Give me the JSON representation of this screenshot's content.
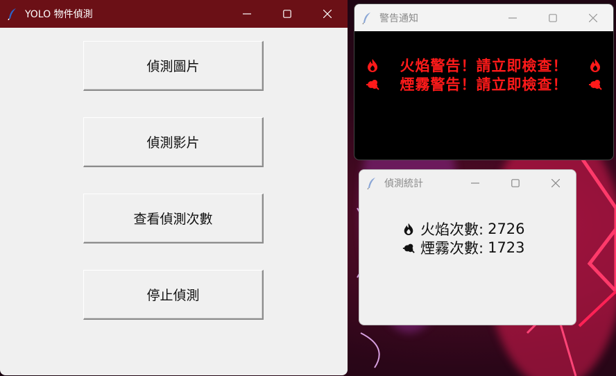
{
  "main_window": {
    "title": "YOLO 物件偵測",
    "buttons": [
      "偵測圖片",
      "偵測影片",
      "查看偵測次數",
      "停止偵測"
    ]
  },
  "alert_window": {
    "title": "警告通知",
    "fire_message": "火焰警告！請立即檢查！",
    "smoke_message": "煙霧警告！請立即檢查！",
    "text_color": "#ff1a1a"
  },
  "stats_window": {
    "title": "偵測統計",
    "fire_label": "火焰次數:",
    "fire_count": "2726",
    "smoke_label": "煙霧次數:",
    "smoke_count": "1723"
  },
  "icons": {
    "window": "feather-icon",
    "minimize": "minimize-icon",
    "maximize": "maximize-icon",
    "close": "close-icon",
    "fire": "flame-icon",
    "smoke": "smoke-icon"
  },
  "colors": {
    "main_titlebar": "#6b1016",
    "alert_background": "#000000",
    "window_background": "#f0f0f0"
  }
}
